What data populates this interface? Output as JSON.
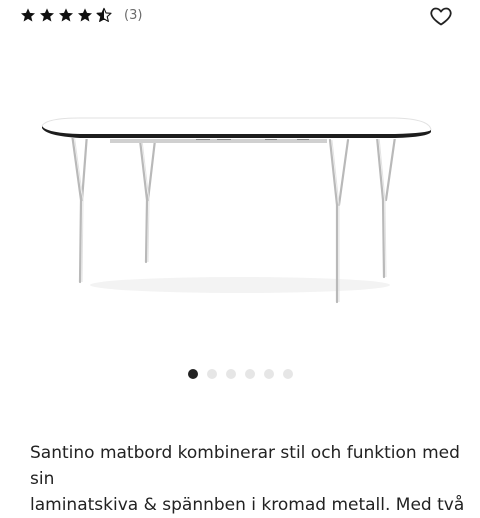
{
  "rating": {
    "stars": 4.5,
    "max_stars": 5,
    "count_text": "(3)",
    "star_color": "#111111"
  },
  "favorite": {
    "icon": "heart-outline-icon"
  },
  "product_image": {
    "description_alt": "Santino matbord"
  },
  "carousel": {
    "total": 6,
    "active_index": 0
  },
  "description": {
    "line1": "Santino matbord kombinerar stil och funktion med sin",
    "line2": "laminatskiva & spännben i kromad metall. Med två"
  }
}
